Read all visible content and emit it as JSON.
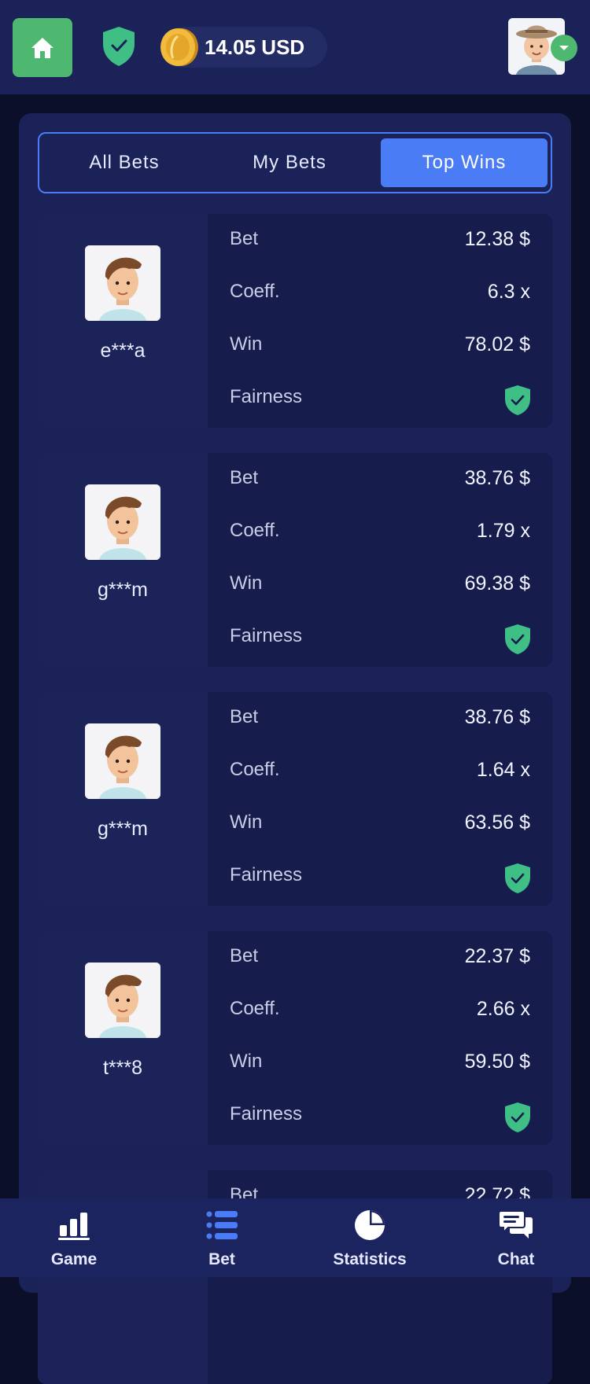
{
  "header": {
    "balance": "14.05 USD",
    "home_icon": "home-icon",
    "shield_icon": "shield-check-icon",
    "coin_icon": "coin-icon",
    "avatar_icon": "user-avatar",
    "dropdown_icon": "chevron-down-icon"
  },
  "tabs": [
    {
      "label": "All Bets",
      "active": false
    },
    {
      "label": "My Bets",
      "active": false
    },
    {
      "label": "Top Wins",
      "active": true
    }
  ],
  "labels": {
    "bet": "Bet",
    "coeff": "Coeff.",
    "win": "Win",
    "fairness": "Fairness"
  },
  "wins": [
    {
      "user": "e***a",
      "bet": "12.38 $",
      "coeff": "6.3 x",
      "win": "78.02 $"
    },
    {
      "user": "g***m",
      "bet": "38.76 $",
      "coeff": "1.79 x",
      "win": "69.38 $"
    },
    {
      "user": "g***m",
      "bet": "38.76 $",
      "coeff": "1.64 x",
      "win": "63.56 $"
    },
    {
      "user": "t***8",
      "bet": "22.37 $",
      "coeff": "2.66 x",
      "win": "59.50 $"
    },
    {
      "user": "",
      "bet": "22.72 $",
      "coeff": "",
      "win": ""
    }
  ],
  "nav": [
    {
      "label": "Game",
      "icon": "bar-chart-icon"
    },
    {
      "label": "Bet",
      "icon": "list-icon"
    },
    {
      "label": "Statistics",
      "icon": "pie-chart-icon"
    },
    {
      "label": "Chat",
      "icon": "chat-icon"
    }
  ],
  "colors": {
    "accent": "#4a7cf6",
    "green": "#4fb870",
    "fair": "#3fbf85"
  }
}
